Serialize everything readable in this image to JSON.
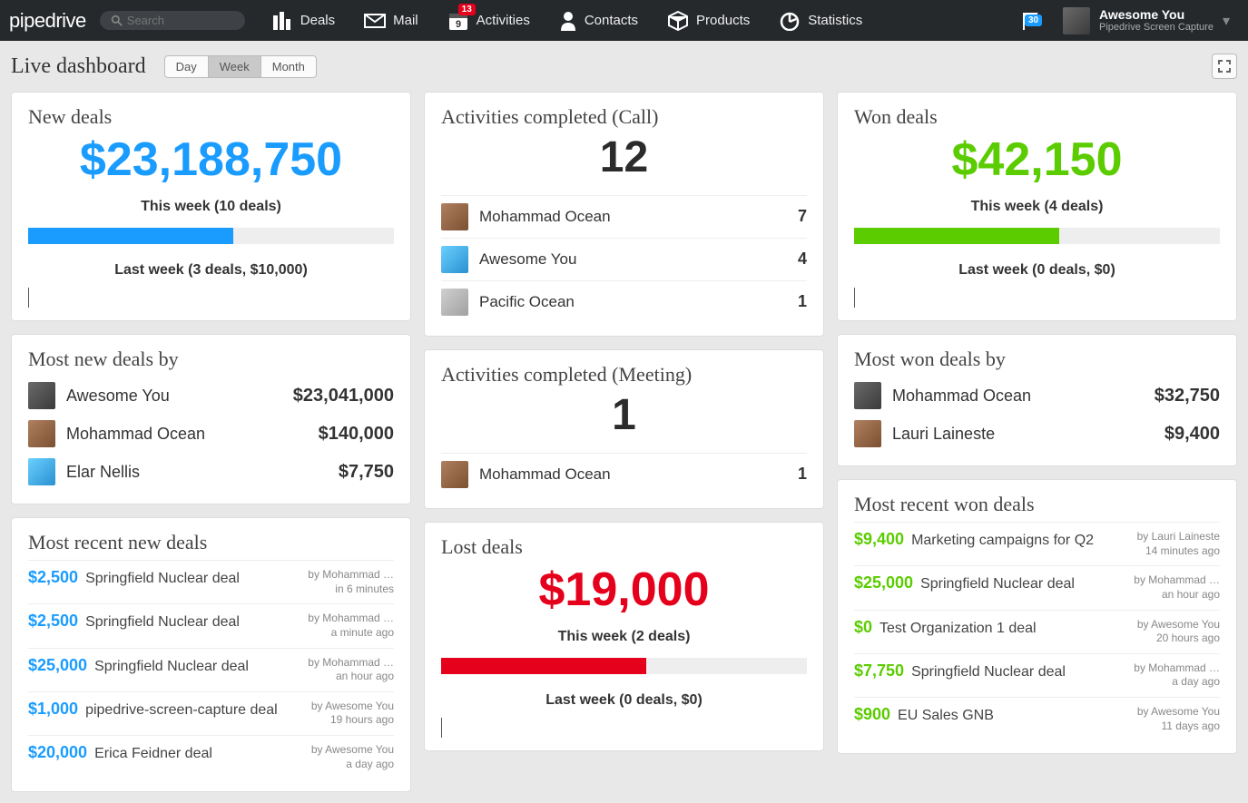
{
  "brand": "pipedrive",
  "search": {
    "placeholder": "Search"
  },
  "nav": {
    "deals": "Deals",
    "mail": "Mail",
    "activities": "Activities",
    "activities_badge": "13",
    "activities_day": "9",
    "contacts": "Contacts",
    "products": "Products",
    "statistics": "Statistics",
    "flag_badge": "30"
  },
  "user": {
    "name": "Awesome You",
    "sub": "Pipedrive Screen Capture"
  },
  "page": {
    "title": "Live dashboard",
    "toggles": {
      "day": "Day",
      "week": "Week",
      "month": "Month",
      "active": "week"
    }
  },
  "new_deals": {
    "title": "New deals",
    "amount": "$23,188,750",
    "this_week": "This week (10 deals)",
    "bar_pct": 56,
    "last_week": "Last week (3 deals, $10,000)"
  },
  "most_new_by": {
    "title": "Most new deals by",
    "rows": [
      {
        "name": "Awesome You",
        "val": "$23,041,000"
      },
      {
        "name": "Mohammad Ocean",
        "val": "$140,000"
      },
      {
        "name": "Elar Nellis",
        "val": "$7,750"
      }
    ]
  },
  "recent_new": {
    "title": "Most recent new deals",
    "rows": [
      {
        "amount": "$2,500",
        "name": "Springfield Nuclear deal",
        "by": "by Mohammad …",
        "when": "in 6 minutes"
      },
      {
        "amount": "$2,500",
        "name": "Springfield Nuclear deal",
        "by": "by Mohammad …",
        "when": "a minute ago"
      },
      {
        "amount": "$25,000",
        "name": "Springfield Nuclear deal",
        "by": "by Mohammad …",
        "when": "an hour ago"
      },
      {
        "amount": "$1,000",
        "name": "pipedrive-screen-capture deal",
        "by": "by Awesome You",
        "when": "19 hours ago"
      },
      {
        "amount": "$20,000",
        "name": "Erica Feidner deal",
        "by": "by Awesome You",
        "when": "a day ago"
      }
    ]
  },
  "act_call": {
    "title": "Activities completed (Call)",
    "count": "12",
    "rows": [
      {
        "name": "Mohammad Ocean",
        "val": "7"
      },
      {
        "name": "Awesome You",
        "val": "4"
      },
      {
        "name": "Pacific Ocean",
        "val": "1"
      }
    ]
  },
  "act_meeting": {
    "title": "Activities completed (Meeting)",
    "count": "1",
    "rows": [
      {
        "name": "Mohammad Ocean",
        "val": "1"
      }
    ]
  },
  "lost_deals": {
    "title": "Lost deals",
    "amount": "$19,000",
    "this_week": "This week (2 deals)",
    "bar_pct": 56,
    "last_week": "Last week (0 deals, $0)"
  },
  "won_deals": {
    "title": "Won deals",
    "amount": "$42,150",
    "this_week": "This week (4 deals)",
    "bar_pct": 56,
    "last_week": "Last week (0 deals, $0)"
  },
  "most_won_by": {
    "title": "Most won deals by",
    "rows": [
      {
        "name": "Mohammad Ocean",
        "val": "$32,750"
      },
      {
        "name": "Lauri Laineste",
        "val": "$9,400"
      }
    ]
  },
  "recent_won": {
    "title": "Most recent won deals",
    "rows": [
      {
        "amount": "$9,400",
        "name": "Marketing campaigns for Q2",
        "by": "by Lauri Laineste",
        "when": "14 minutes ago"
      },
      {
        "amount": "$25,000",
        "name": "Springfield Nuclear deal",
        "by": "by Mohammad …",
        "when": "an hour ago"
      },
      {
        "amount": "$0",
        "name": "Test Organization 1 deal",
        "by": "by Awesome You",
        "when": "20 hours ago"
      },
      {
        "amount": "$7,750",
        "name": "Springfield Nuclear deal",
        "by": "by Mohammad …",
        "when": "a day ago"
      },
      {
        "amount": "$900",
        "name": "EU Sales GNB",
        "by": "by Awesome You",
        "when": "11 days ago"
      }
    ]
  }
}
